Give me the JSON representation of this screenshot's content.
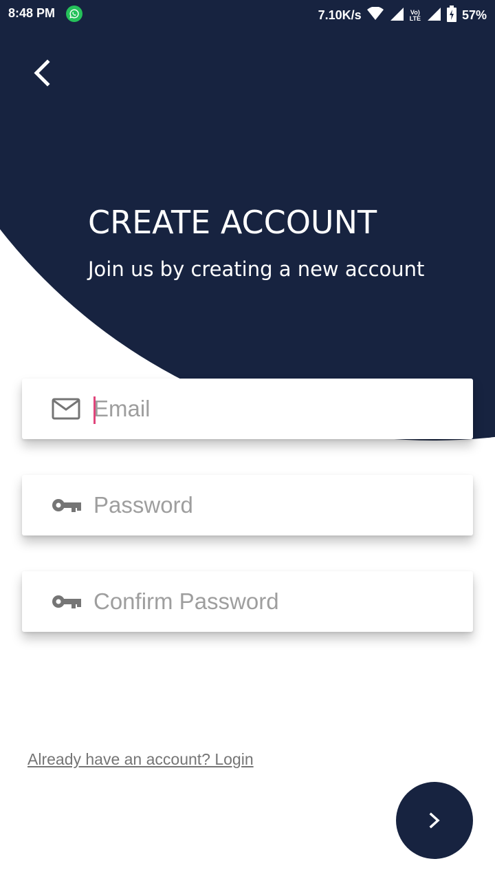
{
  "status_bar": {
    "time": "8:48 PM",
    "net_speed": "7.10K/s",
    "volte_line1": "Vo)",
    "volte_line2": "LTE",
    "battery": "57%"
  },
  "header": {
    "title": "CREATE ACCOUNT",
    "subtitle": "Join us by creating a new account"
  },
  "form": {
    "email_placeholder": "Email",
    "password_placeholder": "Password",
    "confirm_password_placeholder": "Confirm Password"
  },
  "footer": {
    "login_link": "Already have an account? Login"
  },
  "icons": {
    "back": "chevron-left-icon",
    "email": "mail-icon",
    "password": "key-icon",
    "confirm": "key-icon",
    "next": "chevron-right-icon"
  },
  "colors": {
    "primary": "#172340",
    "cursor": "#e0457b",
    "whatsapp": "#25c15a"
  }
}
